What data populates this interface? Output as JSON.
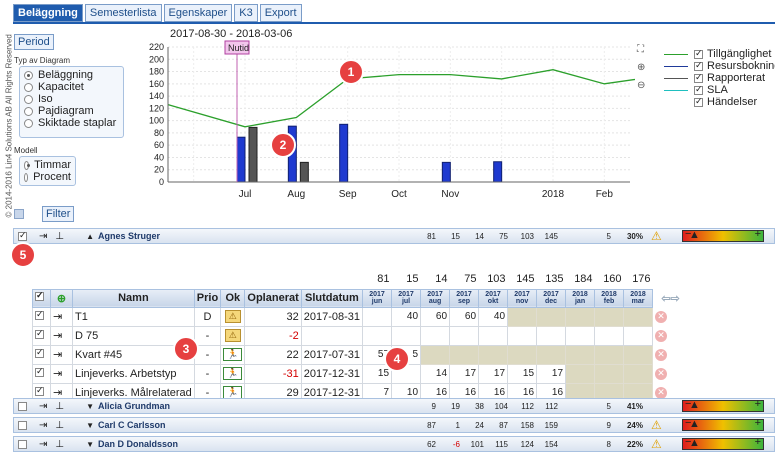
{
  "copyright": "© 2014-2016 Lin4 Solutions AB All Rights Reserved",
  "tabs": [
    "Beläggning",
    "Semesterlista",
    "Egenskaper",
    "K3",
    "Export"
  ],
  "period_button": "Period",
  "chart_type": {
    "title": "Typ av Diagram",
    "options": [
      "Beläggning",
      "Kapacitet",
      "Iso",
      "Pajdiagram",
      "Skiktade staplar"
    ],
    "selected": "Beläggning"
  },
  "model": {
    "title": "Modell",
    "options": [
      "Timmar",
      "Procent"
    ],
    "selected": "Timmar"
  },
  "filter_button": "Filter",
  "chart_data": {
    "type": "bar",
    "title": "2017-08-30 - 2018-03-06",
    "now_marker": "Nutid",
    "y_ticks": [
      0,
      20,
      40,
      60,
      80,
      100,
      120,
      140,
      160,
      180,
      200,
      220
    ],
    "ylim": [
      0,
      220
    ],
    "x_tick_labels": [
      "Jul",
      "Aug",
      "Sep",
      "Oct",
      "Nov",
      "2018",
      "Feb"
    ],
    "bars_blue": [
      {
        "month": "Jul",
        "value": 73
      },
      {
        "month": "Aug",
        "value": 91
      },
      {
        "month": "Sep",
        "value": 94
      },
      {
        "month": "Nov",
        "value": 32
      },
      {
        "month": "Dec",
        "value": 33
      }
    ],
    "bars_gray": [
      {
        "month": "Jul",
        "value": 89
      },
      {
        "month": "Aug",
        "value": 32
      }
    ],
    "line_series": {
      "name": "Tillgänglighet",
      "points": [
        {
          "x": "Jun",
          "y": 126
        },
        {
          "x": "Jul",
          "y": 90
        },
        {
          "x": "Aug",
          "y": 105
        },
        {
          "x": "Sep",
          "y": 168
        },
        {
          "x": "Oct",
          "y": 175
        },
        {
          "x": "Nov",
          "y": 175
        },
        {
          "x": "Dec",
          "y": 168
        },
        {
          "x": "Jan",
          "y": 183
        },
        {
          "x": "Feb",
          "y": 160
        },
        {
          "x": "Mar",
          "y": 172
        }
      ]
    },
    "legend": [
      {
        "label": "Tillgänglighet",
        "color": "#2ca02c"
      },
      {
        "label": "Resursbokning",
        "color": "#1f3a9a"
      },
      {
        "label": "Rapporterat",
        "color": "#555555"
      },
      {
        "label": "SLA",
        "color": "#1fbfbf"
      },
      {
        "label": "Händelser",
        "color": ""
      }
    ]
  },
  "groups": [
    {
      "name": "Agnes Struger",
      "values": [
        "81",
        "15",
        "14",
        "75",
        "103",
        "145"
      ],
      "count": "5",
      "pct": "30%"
    },
    {
      "name": "Alicia Grundman",
      "values": [
        "9",
        "19",
        "38",
        "104",
        "112",
        "112"
      ],
      "count": "5",
      "pct": "41%"
    },
    {
      "name": "Carl C Carlsson",
      "values": [
        "87",
        "1",
        "24",
        "87",
        "158",
        "159"
      ],
      "count": "9",
      "pct": "24%"
    },
    {
      "name": "Dan D Donaldsson",
      "values": [
        "62",
        "-6",
        "101",
        "115",
        "124",
        "154"
      ],
      "count": "8",
      "pct": "22%"
    }
  ],
  "detail": {
    "month_totals": [
      "81",
      "15",
      "14",
      "75",
      "103",
      "145",
      "135",
      "184",
      "160",
      "176"
    ],
    "headers": [
      "Namn",
      "Prio",
      "Ok",
      "Oplanerat",
      "Slutdatum"
    ],
    "months": [
      "2017 jun",
      "2017 jul",
      "2017 aug",
      "2017 sep",
      "2017 okt",
      "2017 nov",
      "2017 dec",
      "2018 jan",
      "2018 feb",
      "2018 mar"
    ],
    "rows": [
      {
        "name": "T1",
        "prio": "D",
        "ok": "warn",
        "oplanerat": "32",
        "slut": "2017-08-31",
        "cells": [
          "",
          "40",
          "60",
          "60",
          "40",
          "",
          "",
          "",
          "",
          ""
        ]
      },
      {
        "name": "D 75",
        "prio": "-",
        "ok": "warn",
        "oplanerat": "-2",
        "slut": "",
        "cells": [
          "",
          "",
          "",
          "",
          "",
          "",
          "",
          "",
          "",
          ""
        ]
      },
      {
        "name": "Kvart #45",
        "prio": "-",
        "ok": "run",
        "oplanerat": "22",
        "slut": "2017-07-31",
        "cells": [
          "57",
          "5",
          "",
          "",
          "",
          "",
          "",
          "",
          "",
          ""
        ]
      },
      {
        "name": "Linjeverks. Arbetstyp",
        "prio": "-",
        "ok": "run",
        "oplanerat": "-31",
        "slut": "2017-12-31",
        "cells": [
          "15",
          "",
          "14",
          "17",
          "17",
          "15",
          "17",
          "",
          "",
          ""
        ]
      },
      {
        "name": "Linjeverks. Målrelaterad",
        "prio": "-",
        "ok": "run",
        "oplanerat": "29",
        "slut": "2017-12-31",
        "cells": [
          "7",
          "10",
          "16",
          "16",
          "16",
          "16",
          "16",
          "",
          "",
          ""
        ]
      }
    ]
  },
  "callouts": [
    "1",
    "2",
    "3",
    "4",
    "5"
  ]
}
